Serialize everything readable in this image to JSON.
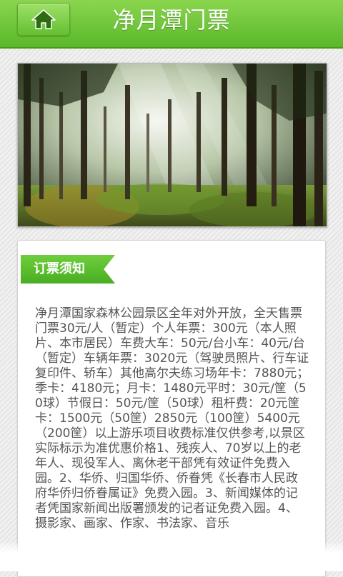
{
  "header": {
    "title": "净月潭门票",
    "home_icon": "home-icon"
  },
  "banner": {
    "image_desc_icon": "forest-photo"
  },
  "section": {
    "label": "订票须知",
    "text": "净月潭国家森林公园景区全年对外开放，全天售票门票30元/人（暂定）个人年票：300元（本人照片、本市居民）车费大车：50元/台小车：40元/台（暂定）车辆年票：3020元（驾驶员照片、行车证复印件、轿车）其他高尔夫练习场年卡：7880元；季卡：4180元；月卡：1480元平时：30元/筐（50球）节假日：50元/筐（50球）租杆费：20元筐卡：1500元（50筐）2850元（100筐）5400元（200筐）以上游乐项目收费标准仅供参考,以景区实际标示为准优惠价格1、残疾人、70岁以上的老年人、现役军人、离休老干部凭有效证件免费入园。2、华侨、归国华侨、侨眷凭《长春市人民政府华侨归侨眷属证》免费入园。3、新闻媒体的记者凭国家新闻出版署颁发的记者证免费入园。4、摄影家、画家、作家、书法家、音乐"
  },
  "colors": {
    "header": "#5bb82a",
    "accent": "#49ad22",
    "text": "#555555"
  }
}
